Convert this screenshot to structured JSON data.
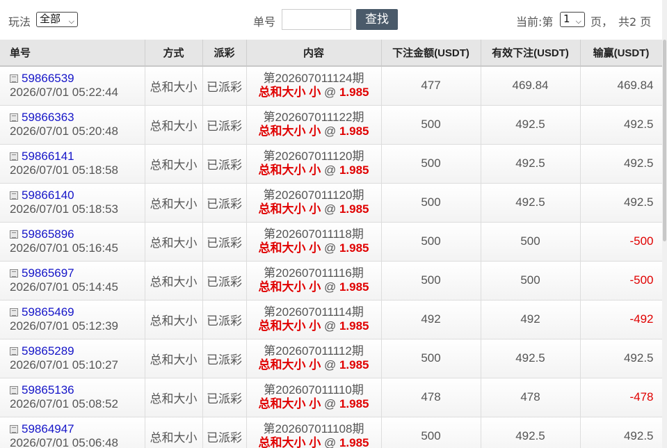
{
  "toolbar": {
    "play_label": "玩法",
    "play_value": "全部",
    "no_label": "单号",
    "no_value": "",
    "search_label": "查找",
    "current_label": "当前:第",
    "current_page": "1",
    "page_unit": "页，",
    "total_pages": "共2 页"
  },
  "table": {
    "headers": [
      "单号",
      "方式",
      "派彩",
      "内容",
      "下注金额(USDT)",
      "有效下注(USDT)",
      "输赢(USDT)"
    ],
    "rows": [
      {
        "order_no": "59866539",
        "time": "2026/07/01 05:22:44",
        "method": "总和大小",
        "status": "已派彩",
        "issue": "第202607011124期",
        "bet": "总和大小 小",
        "at": "@",
        "odds": "1.985",
        "amount": "477",
        "effective": "469.84",
        "winloss": "469.84",
        "neg": false
      },
      {
        "order_no": "59866363",
        "time": "2026/07/01 05:20:48",
        "method": "总和大小",
        "status": "已派彩",
        "issue": "第202607011122期",
        "bet": "总和大小 小",
        "at": "@",
        "odds": "1.985",
        "amount": "500",
        "effective": "492.5",
        "winloss": "492.5",
        "neg": false
      },
      {
        "order_no": "59866141",
        "time": "2026/07/01 05:18:58",
        "method": "总和大小",
        "status": "已派彩",
        "issue": "第202607011120期",
        "bet": "总和大小 小",
        "at": "@",
        "odds": "1.985",
        "amount": "500",
        "effective": "492.5",
        "winloss": "492.5",
        "neg": false
      },
      {
        "order_no": "59866140",
        "time": "2026/07/01 05:18:53",
        "method": "总和大小",
        "status": "已派彩",
        "issue": "第202607011120期",
        "bet": "总和大小 小",
        "at": "@",
        "odds": "1.985",
        "amount": "500",
        "effective": "492.5",
        "winloss": "492.5",
        "neg": false
      },
      {
        "order_no": "59865896",
        "time": "2026/07/01 05:16:45",
        "method": "总和大小",
        "status": "已派彩",
        "issue": "第202607011118期",
        "bet": "总和大小 小",
        "at": "@",
        "odds": "1.985",
        "amount": "500",
        "effective": "500",
        "winloss": "-500",
        "neg": true
      },
      {
        "order_no": "59865697",
        "time": "2026/07/01 05:14:45",
        "method": "总和大小",
        "status": "已派彩",
        "issue": "第202607011116期",
        "bet": "总和大小 小",
        "at": "@",
        "odds": "1.985",
        "amount": "500",
        "effective": "500",
        "winloss": "-500",
        "neg": true
      },
      {
        "order_no": "59865469",
        "time": "2026/07/01 05:12:39",
        "method": "总和大小",
        "status": "已派彩",
        "issue": "第202607011114期",
        "bet": "总和大小 小",
        "at": "@",
        "odds": "1.985",
        "amount": "492",
        "effective": "492",
        "winloss": "-492",
        "neg": true
      },
      {
        "order_no": "59865289",
        "time": "2026/07/01 05:10:27",
        "method": "总和大小",
        "status": "已派彩",
        "issue": "第202607011112期",
        "bet": "总和大小 小",
        "at": "@",
        "odds": "1.985",
        "amount": "500",
        "effective": "492.5",
        "winloss": "492.5",
        "neg": false
      },
      {
        "order_no": "59865136",
        "time": "2026/07/01 05:08:52",
        "method": "总和大小",
        "status": "已派彩",
        "issue": "第202607011110期",
        "bet": "总和大小 小",
        "at": "@",
        "odds": "1.985",
        "amount": "478",
        "effective": "478",
        "winloss": "-478",
        "neg": true
      },
      {
        "order_no": "59864947",
        "time": "2026/07/01 05:06:48",
        "method": "总和大小",
        "status": "已派彩",
        "issue": "第202607011108期",
        "bet": "总和大小 小",
        "at": "@",
        "odds": "1.985",
        "amount": "500",
        "effective": "492.5",
        "winloss": "492.5",
        "neg": false
      }
    ]
  },
  "colors": {
    "link": "#1515c8",
    "negative": "#e00000",
    "button": "#4a5a6a",
    "header_bg": "#e6e6e6"
  }
}
